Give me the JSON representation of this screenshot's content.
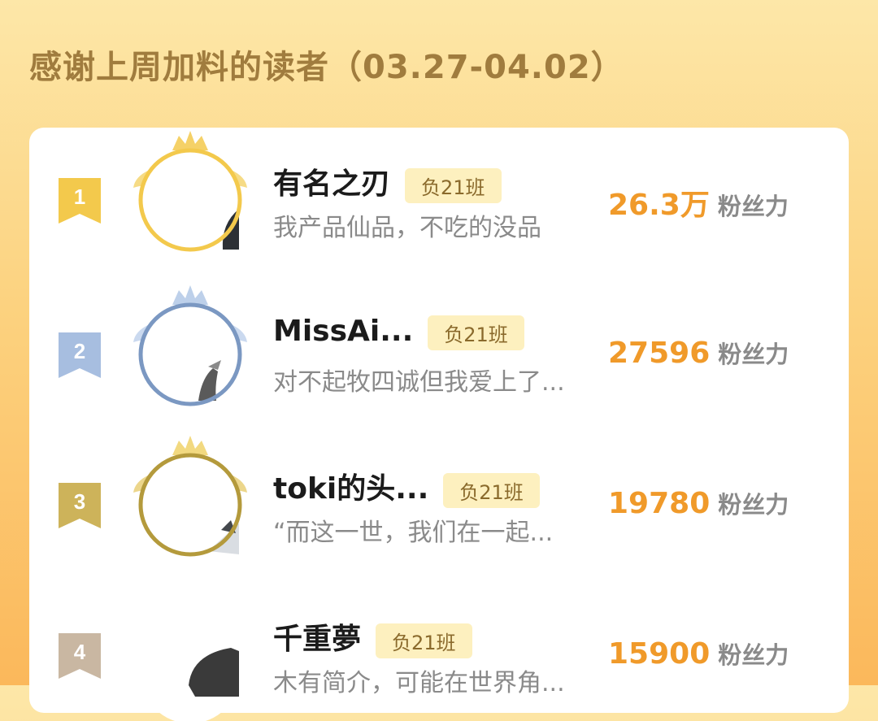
{
  "header": {
    "title": "感谢上周加料的读者（03.27-04.02）"
  },
  "colors": {
    "gold": "#f3c94c",
    "silver": "#7b98c2",
    "bronze": "#c5aa4a",
    "rank4": "#c9b7a2",
    "score": "#f09a2a"
  },
  "readers": [
    {
      "rank": "1",
      "name": "有名之刃",
      "tag": "负21班",
      "bio": "我产品仙品，不吃的没品",
      "score": "26.3万",
      "unit": "粉丝力"
    },
    {
      "rank": "2",
      "name": "MissAi...",
      "tag": "负21班",
      "bio": "对不起牧四诚但我爱上了...",
      "score": "27596",
      "unit": "粉丝力"
    },
    {
      "rank": "3",
      "name": "toki的头...",
      "tag": "负21班",
      "bio": "“而这一世，我们在一起...",
      "score": "19780",
      "unit": "粉丝力"
    },
    {
      "rank": "4",
      "name": "千重夢",
      "tag": "负21班",
      "bio": "木有简介，可能在世界角...",
      "score": "15900",
      "unit": "粉丝力"
    }
  ]
}
